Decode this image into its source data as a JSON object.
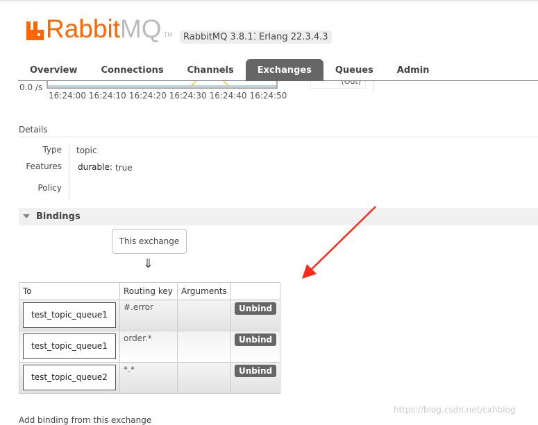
{
  "header": {
    "logo_text_orange": "Rabbit",
    "logo_text_grey": "MQ",
    "logo_tm": "TM",
    "rabbitmq_version": "RabbitMQ 3.8.11",
    "erlang_version": "Erlang 22.3.4.3"
  },
  "nav": {
    "tabs": [
      {
        "label": "Overview"
      },
      {
        "label": "Connections"
      },
      {
        "label": "Channels"
      },
      {
        "label": "Exchanges",
        "active": true
      },
      {
        "label": "Queues"
      },
      {
        "label": "Admin"
      }
    ]
  },
  "chart": {
    "y_label": "0.0 /s",
    "x_ticks": [
      "16:24:00",
      "16:24:10",
      "16:24:20",
      "16:24:30",
      "16:24:40",
      "16:24:50"
    ],
    "legend_partial": "(Out)"
  },
  "details": {
    "title": "Details",
    "type_label": "Type",
    "type_value": "topic",
    "features_label": "Features",
    "feature_key": "durable:",
    "feature_value": "true",
    "policy_label": "Policy"
  },
  "bindings": {
    "title": "Bindings",
    "this_exchange": "This exchange",
    "arrow": "⇓",
    "columns": [
      "To",
      "Routing key",
      "Arguments",
      ""
    ],
    "rows": [
      {
        "to": "test_topic_queue1",
        "routing_key": "#.error",
        "arguments": "",
        "action": "Unbind"
      },
      {
        "to": "test_topic_queue1",
        "routing_key": "order.*",
        "arguments": "",
        "action": "Unbind"
      },
      {
        "to": "test_topic_queue2",
        "routing_key": "*.*",
        "arguments": "",
        "action": "Unbind"
      }
    ]
  },
  "add_binding": "Add binding from this exchange",
  "watermark": "https://blog.csdn.net/cxhblog",
  "colors": {
    "brand": "#ff6600",
    "annotation_arrow": "#ff2a1a",
    "active_tab": "#666666"
  }
}
